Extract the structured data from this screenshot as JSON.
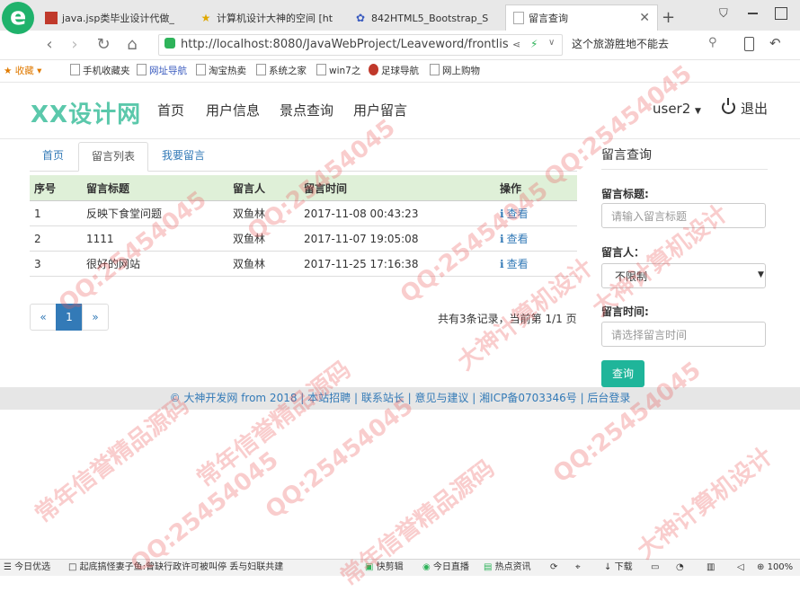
{
  "browser": {
    "tabs": [
      {
        "title": "java.jsp类毕业设计代做_"
      },
      {
        "title": "计算机设计大神的空间 [ht"
      },
      {
        "title": "842HTML5_Bootstrap_S"
      },
      {
        "title": "留言查询",
        "active": true
      }
    ],
    "new_tab": "+",
    "url": "http://localhost:8080/JavaWebProject/Leaveword/frontlis",
    "search_text": "这个旅游胜地不能去",
    "bookmarks": [
      "收藏",
      "手机收藏夹",
      "网址导航",
      "淘宝热卖",
      "系统之家",
      "win7之",
      "足球导航",
      "网上购物"
    ]
  },
  "site": {
    "brand": "XX设计网",
    "nav": [
      "首页",
      "用户信息",
      "景点查询",
      "用户留言"
    ],
    "user": "user2",
    "logout": "退出"
  },
  "main": {
    "tabs": [
      "首页",
      "留言列表",
      "我要留言"
    ],
    "table": {
      "headers": [
        "序号",
        "留言标题",
        "留言人",
        "留言时间",
        "操作"
      ],
      "rows": [
        {
          "no": "1",
          "title": "反映下食堂问题",
          "author": "双鱼林",
          "time": "2017-11-08 00:43:23",
          "action": "查看"
        },
        {
          "no": "2",
          "title": "1111",
          "author": "双鱼林",
          "time": "2017-11-07 19:05:08",
          "action": "查看"
        },
        {
          "no": "3",
          "title": "很好的网站",
          "author": "双鱼林",
          "time": "2017-11-25 17:16:38",
          "action": "查看"
        }
      ]
    },
    "pagination": {
      "prev": "«",
      "current": "1",
      "next": "»",
      "info": "共有3条记录，当前第 1/1 页"
    }
  },
  "sidebar": {
    "title": "留言查询",
    "title_label": "留言标题:",
    "title_placeholder": "请输入留言标题",
    "author_label": "留言人：",
    "author_value": "不限制",
    "time_label": "留言时间:",
    "time_placeholder": "请选择留言时间",
    "button": "查询"
  },
  "footer": {
    "text": "© 大神开发网 from 2018 | 本站招聘 | 联系站长 | 意见与建议 | 湘ICP备0703346号 | 后台登录"
  },
  "statusbar": {
    "items": [
      "今日优选",
      "起底搞怪妻子鱼:曾缺行政许可被叫停 丢与妇联共建",
      "快剪辑",
      "今日直播",
      "热点资讯",
      "下载",
      "100%"
    ]
  },
  "watermarks": {
    "qq": "QQ:25454045",
    "cn1": "常年信誉精品源码",
    "cn2": "大神计算机设计"
  },
  "colors": {
    "brand": "#5bc8ab",
    "link": "#337ab7",
    "table_header": "#dff0d8",
    "button": "#1fb59a"
  }
}
